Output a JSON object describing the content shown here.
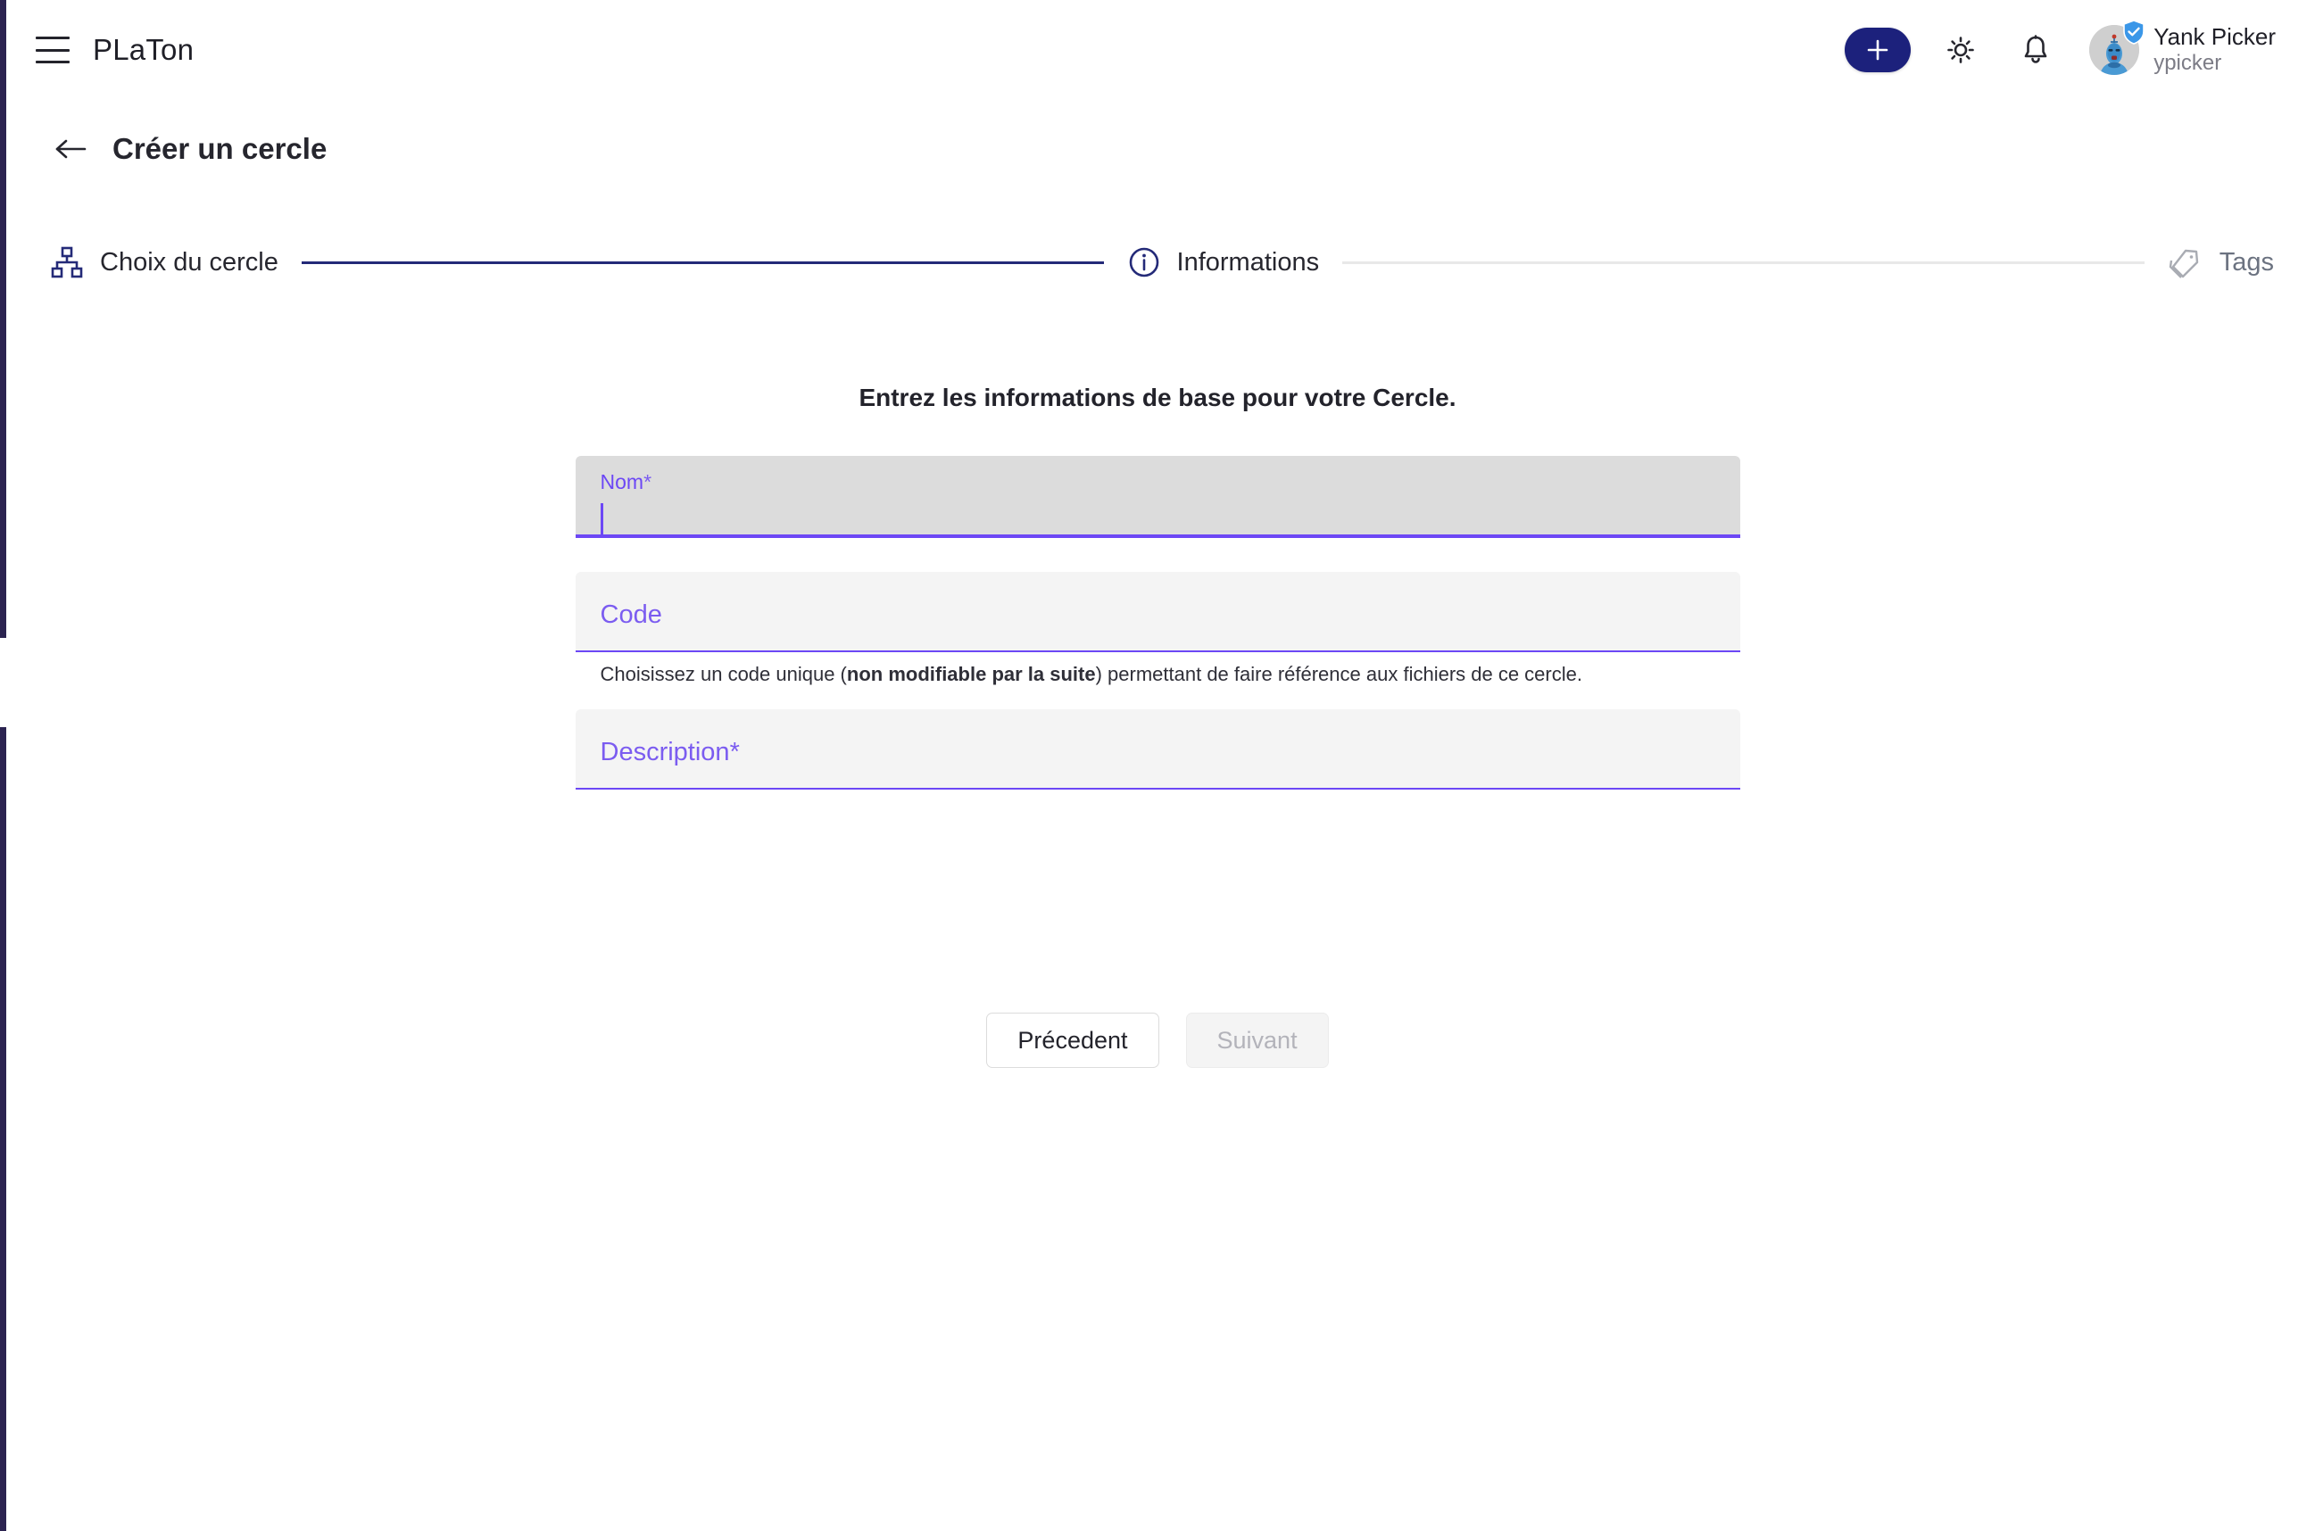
{
  "theme": {
    "rail_color": "#2b2350",
    "brand_blue": "#1c217c",
    "accent_purple": "#6c47f5",
    "step_done_line": "#242a78",
    "step_todo_line": "#e8e8e8"
  },
  "appbar": {
    "menu_icon": "hamburger-menu-icon",
    "brand": "PLaTon",
    "add_label": "+",
    "add_icon": "plus-icon",
    "theme_icon": "sun-icon",
    "notifications_icon": "bell-icon",
    "avatar_icon": "robot-avatar",
    "verified_icon": "verified-shield-icon",
    "user": {
      "fullname": "Yank Picker",
      "handle": "ypicker"
    }
  },
  "header": {
    "back_icon": "arrow-left-icon",
    "title": "Créer un cercle"
  },
  "stepper": {
    "steps": [
      {
        "label": "Choix du cercle",
        "icon": "sitemap-icon",
        "state": "done"
      },
      {
        "label": "Informations",
        "icon": "info-circle-icon",
        "state": "active"
      },
      {
        "label": "Tags",
        "icon": "tag-icon",
        "state": "todo"
      }
    ]
  },
  "form": {
    "intro": "Entrez les informations de base pour votre Cercle.",
    "fields": {
      "nom": {
        "label": "Nom",
        "required_marker": "*",
        "value": "",
        "state": "focused"
      },
      "code": {
        "label": "Code",
        "required_marker": "",
        "value": "",
        "state": "idle",
        "help_prefix": "Choisissez un code unique (",
        "help_bold": "non modifiable par la suite",
        "help_suffix": ") permettant de faire référence aux fichiers de ce cercle."
      },
      "description": {
        "label": "Description",
        "required_marker": "*",
        "value": "",
        "state": "idle"
      }
    },
    "actions": {
      "previous": "Précedent",
      "next": "Suivant"
    }
  }
}
